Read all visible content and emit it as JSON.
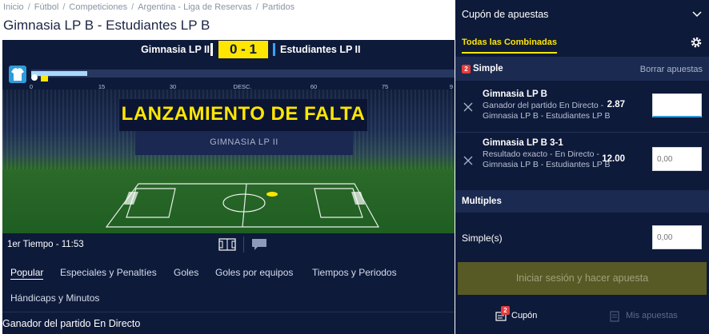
{
  "breadcrumb": [
    "Inicio",
    "Fútbol",
    "Competiciones",
    "Argentina - Liga de Reservas",
    "Partidos"
  ],
  "page_title": "Gimnasia LP B - Estudiantes LP B",
  "scoreboard": {
    "home": "Gimnasia LP II",
    "score": "0 - 1",
    "away": "Estudiantes LP II",
    "home_color": "#ffffff",
    "away_color": "#3ba0ff",
    "score_bg": "#ffe600"
  },
  "timeline": {
    "ticks": [
      "0",
      "15",
      "30",
      "DESC.",
      "60",
      "75",
      "9"
    ],
    "progress_minutes": 11.88
  },
  "event": {
    "title": "LANZAMIENTO DE FALTA",
    "team": "GIMNASIA LP II"
  },
  "match_footer": {
    "period": "1er Tiempo - 11:53",
    "buttons": [
      "field-view-icon",
      "chat-icon"
    ]
  },
  "tabs": [
    "Popular",
    "Especiales y Penaltíes",
    "Goles",
    "Goles por equipos",
    "Tiempos y Periodos",
    "Hándicaps y Minutos"
  ],
  "market": {
    "title": "Ganador del partido En Directo"
  },
  "slip": {
    "title": "Cupón de apuestas",
    "tab": "Todas las Combinadas",
    "simple_count": "2",
    "simple_label": "Simple",
    "clear": "Borrar apuestas",
    "bets": [
      {
        "name": "Gimnasia LP B",
        "desc": "Ganador del partido En Directo - Gimnasia LP B - Estudiantes LP B",
        "odds": "2.87",
        "stake": ""
      },
      {
        "name": "Gimnasia LP B 3-1",
        "desc": "Resultado exacto - En Directo - Gimnasia LP B - Estudiantes LP B",
        "odds": "12.00",
        "stake_placeholder": "0,00"
      }
    ],
    "multiples": "Multiples",
    "simples_label": "Simple(s)",
    "simples_placeholder": "0,00",
    "place_bet": "Iniciar sesión y hacer apuesta",
    "bottom": {
      "coupon": "Cupón",
      "coupon_count": "2",
      "my_bets": "Mis apuestas"
    },
    "accent": "#ffe600"
  }
}
